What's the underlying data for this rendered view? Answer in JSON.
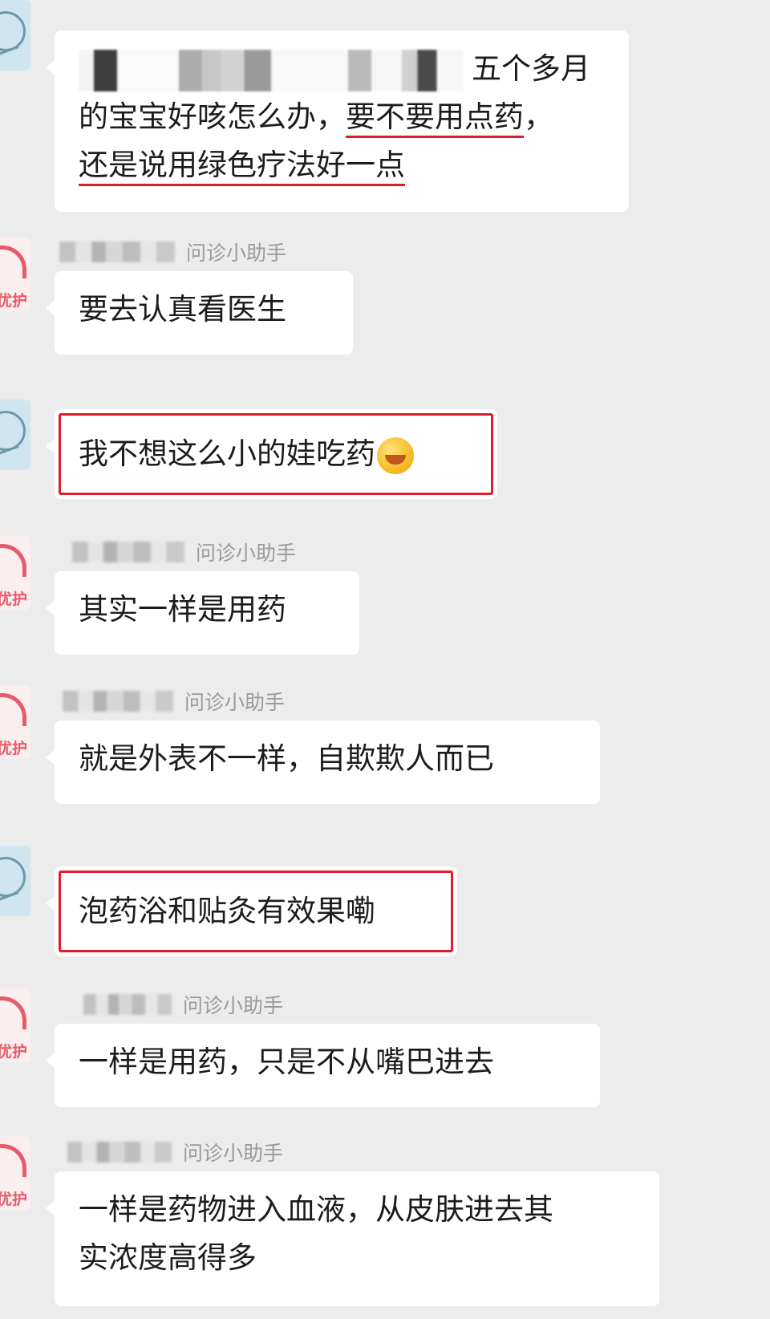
{
  "chat": {
    "assistant_name": "问诊小助手",
    "assistant_logo_text": "优护",
    "messages": [
      {
        "role": "user",
        "lines": [
          "五个多月",
          "的宝宝好咳怎么办，",
          "要不要用点药",
          "，",
          "还是说用绿色疗法好一点"
        ],
        "underlined": [
          "要不要用点药",
          "还是说用绿色疗法好一点"
        ]
      },
      {
        "role": "assistant",
        "sender": "问诊小助手",
        "text": "要去认真看医生"
      },
      {
        "role": "user",
        "text": "我不想这么小的娃吃药",
        "emoji": "crying-laughing-face",
        "highlighted": true
      },
      {
        "role": "assistant",
        "sender": "问诊小助手",
        "text": "其实一样是用药"
      },
      {
        "role": "assistant",
        "sender": "问诊小助手",
        "text": "就是外表不一样，自欺欺人而已"
      },
      {
        "role": "user",
        "text": "泡药浴和贴灸有效果嘞",
        "highlighted": true
      },
      {
        "role": "assistant",
        "sender": "问诊小助手",
        "text": "一样是用药，只是不从嘴巴进去"
      },
      {
        "role": "assistant",
        "sender": "问诊小助手",
        "lines": [
          "一样是药物进入血液，从皮肤进去其",
          "实浓度高得多"
        ]
      }
    ]
  },
  "colors": {
    "background": "#ececec",
    "bubble": "#ffffff",
    "highlight_red": "#e01d2d",
    "sender_gray": "#9a9a9a",
    "brand_red": "#e85a6a"
  }
}
